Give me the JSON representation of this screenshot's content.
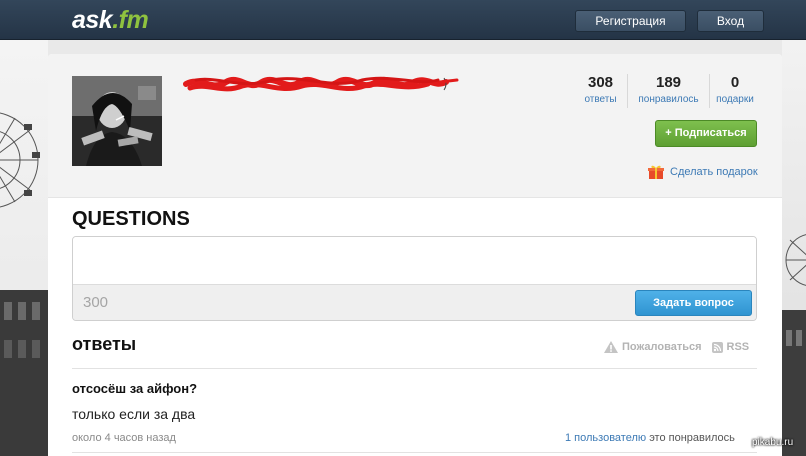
{
  "brand": {
    "logo_main": "ask",
    "logo_tld": ".fm"
  },
  "header": {
    "register_label": "Регистрация",
    "login_label": "Вход"
  },
  "profile": {
    "stats": [
      {
        "value": "308",
        "label": "ответы"
      },
      {
        "value": "189",
        "label": "понравилось"
      },
      {
        "value": "0",
        "label": "подарки"
      }
    ],
    "subscribe_label": "+ Подписаться",
    "gift_label": "Сделать подарок",
    "avatar_icon": "avatar-photo"
  },
  "questions": {
    "title": "QUESTIONS",
    "input_placeholder": "",
    "char_count": "300",
    "ask_button": "Задать вопрос"
  },
  "answers": {
    "title": "ответы",
    "report_label": "Пожаловаться",
    "rss_label": "RSS",
    "items": [
      {
        "question": "отсосёш за айфон?",
        "answer": "только если за два",
        "time": "около 4 часов назад",
        "likes_link": "1 пользователю",
        "likes_rest": "это понравилось"
      }
    ]
  },
  "watermark": "pikabu.ru",
  "colors": {
    "topbar": "#2b3d50",
    "logo_accent": "#8fc23f",
    "link": "#3d7ab5",
    "subscribe": "#6bb03f",
    "ask_button": "#3ba2dd",
    "scribble": "#e21b1b"
  }
}
